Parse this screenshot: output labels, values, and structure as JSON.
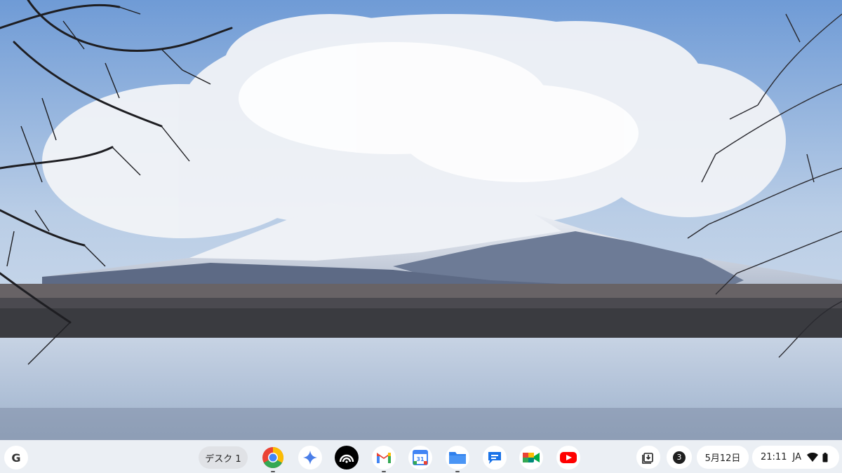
{
  "shelf": {
    "launcher_label": "G",
    "desk_label": "デスク 1",
    "apps": [
      {
        "name": "chrome",
        "icon": "chrome-icon",
        "running": true
      },
      {
        "name": "gemini",
        "icon": "gemini-sparkle-icon",
        "running": false
      },
      {
        "name": "fiber",
        "icon": "fiber-arc-icon",
        "running": false
      },
      {
        "name": "gmail",
        "icon": "gmail-icon",
        "running": true
      },
      {
        "name": "calendar",
        "icon": "calendar-icon",
        "calendar_day": "31",
        "running": false
      },
      {
        "name": "files",
        "icon": "files-folder-icon",
        "running": true
      },
      {
        "name": "messages",
        "icon": "messages-bubble-icon",
        "running": false
      },
      {
        "name": "meet",
        "icon": "meet-camera-icon",
        "running": false
      },
      {
        "name": "youtube",
        "icon": "youtube-play-icon",
        "running": false
      }
    ]
  },
  "tray": {
    "notification_count": "3",
    "date": "5月12日",
    "time": "21:11",
    "ime": "JA"
  },
  "colors": {
    "shelf_bg": "#eceff4",
    "chrome_red": "#ea4335",
    "chrome_yellow": "#fbbc04",
    "chrome_green": "#34a853",
    "chrome_blue": "#4285f4",
    "youtube_red": "#ff0000"
  }
}
